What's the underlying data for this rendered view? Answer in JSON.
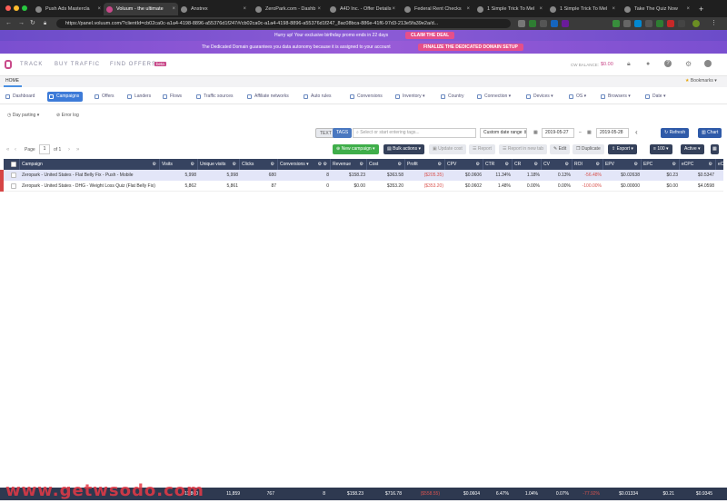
{
  "browser": {
    "tabs": [
      {
        "label": "Push Ads Mastercla"
      },
      {
        "label": "Voluum - the ultimate"
      },
      {
        "label": "Anstrex"
      },
      {
        "label": "ZeroPark.com - Dashb"
      },
      {
        "label": "A4D Inc. - Offer Details"
      },
      {
        "label": "Federal Rent Checks"
      },
      {
        "label": "1 Simple Trick To Mel"
      },
      {
        "label": "1 Simple Trick To Mel"
      },
      {
        "label": "Take The Quiz Now"
      }
    ],
    "url": "https://panel.voluum.com/?clientId=cb02ca0c-a1a4-4198-8896-a55376d1f247#/cb02ca0c-a1a4-4198-8896-a55376d1f247_8ac08bca-886e-41f6-97d3-213e5fa39e2a/d..."
  },
  "promo": {
    "text": "Hurry up! Your exclusive birthday promo ends in 22 days",
    "button": "CLAIM THE DEAL",
    "domain_text": "The Dedicated Domain guarantees you data autonomy because it is assigned to your account",
    "domain_button": "FINALIZE THE DEDICATED DOMAIN SETUP"
  },
  "nav": {
    "items": [
      "TRACK",
      "BUY TRAFFIC",
      "FIND OFFERS"
    ],
    "beta": "beta",
    "balance_label": "CW BALANCE:",
    "balance_value": "$0.00",
    "home": "HOME",
    "bookmarks": "Bookmarks"
  },
  "tabs": [
    {
      "label": "Dashboard"
    },
    {
      "label": "Campaigns"
    },
    {
      "label": "Offers"
    },
    {
      "label": "Landers"
    },
    {
      "label": "Flows"
    },
    {
      "label": "Traffic sources"
    },
    {
      "label": "Affiliate networks"
    },
    {
      "label": "Auto rules"
    },
    {
      "label": "Conversions"
    },
    {
      "label": "Inventory"
    },
    {
      "label": "Country"
    },
    {
      "label": "Connection"
    },
    {
      "label": "Devices"
    },
    {
      "label": "OS"
    },
    {
      "label": "Browsers"
    },
    {
      "label": "Date"
    }
  ],
  "dayparting": "Day parting",
  "errorlog": "Error log",
  "filters": {
    "text": "TEXT",
    "tags": "TAGS",
    "search_placeholder": "Select or start entering tags...",
    "date_range": "Custom date range",
    "date_from": "2019-05-27",
    "date_to": "2019-05-28",
    "refresh": "Refresh",
    "chart": "Chart"
  },
  "pagination": {
    "page_label": "Page",
    "page": "1",
    "of": "of 1"
  },
  "actions": {
    "new_campaign": "New campaign",
    "bulk": "Bulk actions",
    "update_cost": "Update cost",
    "report": "Report",
    "report_new": "Report in new tab",
    "edit": "Edit",
    "duplicate": "Duplicate",
    "export": "Export",
    "per_page": "100",
    "active": "Active"
  },
  "table": {
    "headers": [
      "Campaign",
      "Visits",
      "Unique visits",
      "Clicks",
      "Conversions",
      "Revenue",
      "Cost",
      "Profit",
      "CPV",
      "CTR",
      "CR",
      "CV",
      "ROI",
      "EPV",
      "EPC",
      "eCPC",
      "eC"
    ],
    "rows": [
      [
        "Zeropark - United States - Flat Belly Fix - Push - Mobile",
        "5,998",
        "5,998",
        "680",
        "8",
        "$158.23",
        "$363.58",
        "($205.35)",
        "$0.0606",
        "11.34%",
        "1.18%",
        "0.13%",
        "-56.48%",
        "$0.02638",
        "$0.23",
        "$0.5347",
        ""
      ],
      [
        "Zeropark - United States - DHG - Weight Loss Quiz (Flat Belly Fix)",
        "5,862",
        "5,861",
        "87",
        "0",
        "$0.00",
        "$353.20",
        "($353.20)",
        "$0.0602",
        "1.48%",
        "0.00%",
        "0.00%",
        "-100.00%",
        "$0.00000",
        "$0.00",
        "$4.0598",
        ""
      ]
    ],
    "footer": [
      "11,860",
      "11,859",
      "767",
      "8",
      "$158.23",
      "$716.78",
      "($558.55)",
      "$0.0604",
      "6.47%",
      "1.04%",
      "0.07%",
      "-77.92%",
      "$0.01334",
      "$0.21",
      "$0.9345"
    ]
  },
  "watermark": "www.getwsodo.com",
  "colors": {
    "accent": "#3d7bd8",
    "header": "#364360",
    "promo": "#7a4fd0",
    "negative": "#d9534f"
  }
}
